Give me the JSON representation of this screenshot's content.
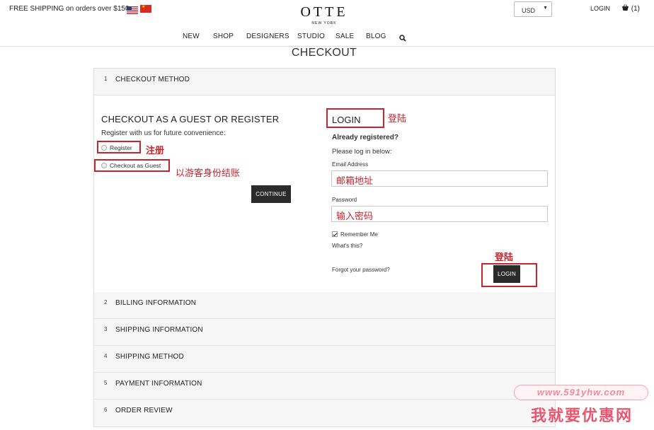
{
  "header": {
    "shipping_notice": "FREE SHIPPING on orders over $150",
    "logo": "OTTE",
    "logo_sub": "NEW YORK",
    "currency": "USD",
    "login": "LOGIN",
    "cart_count": "(1)"
  },
  "nav": [
    "NEW",
    "SHOP",
    "DESIGNERS",
    "STUDIO",
    "SALE",
    "BLOG"
  ],
  "page_title": "CHECKOUT",
  "steps": [
    {
      "num": "1",
      "label": "CHECKOUT METHOD"
    },
    {
      "num": "2",
      "label": "BILLING INFORMATION"
    },
    {
      "num": "3",
      "label": "SHIPPING INFORMATION"
    },
    {
      "num": "4",
      "label": "SHIPPING METHOD"
    },
    {
      "num": "5",
      "label": "PAYMENT INFORMATION"
    },
    {
      "num": "6",
      "label": "ORDER REVIEW"
    }
  ],
  "guest": {
    "heading": "CHECKOUT AS A GUEST OR REGISTER",
    "subtext": "Register with us for future convenience:",
    "option_register": "Register",
    "option_guest": "Checkout as Guest",
    "continue": "CONTINUE"
  },
  "login": {
    "heading": "LOGIN",
    "already": "Already registered?",
    "please": "Please log in below:",
    "email_label": "Email Address",
    "email_value": "邮箱地址",
    "password_label": "Password",
    "password_value": "输入密码",
    "remember": "Remember Me",
    "whats_this": "What's this?",
    "forgot": "Forgot your password?",
    "button": "LOGIN"
  },
  "annotations": {
    "login_note": "登陆",
    "register_note": "注册",
    "guest_note": "以游客身份结账",
    "login_button_note": "登陆"
  },
  "watermark": {
    "url": "www.591yhw.com",
    "name": "我就要优惠网"
  },
  "colors": {
    "annotation": "#c8242b",
    "button_dark": "#2b2b2b"
  }
}
